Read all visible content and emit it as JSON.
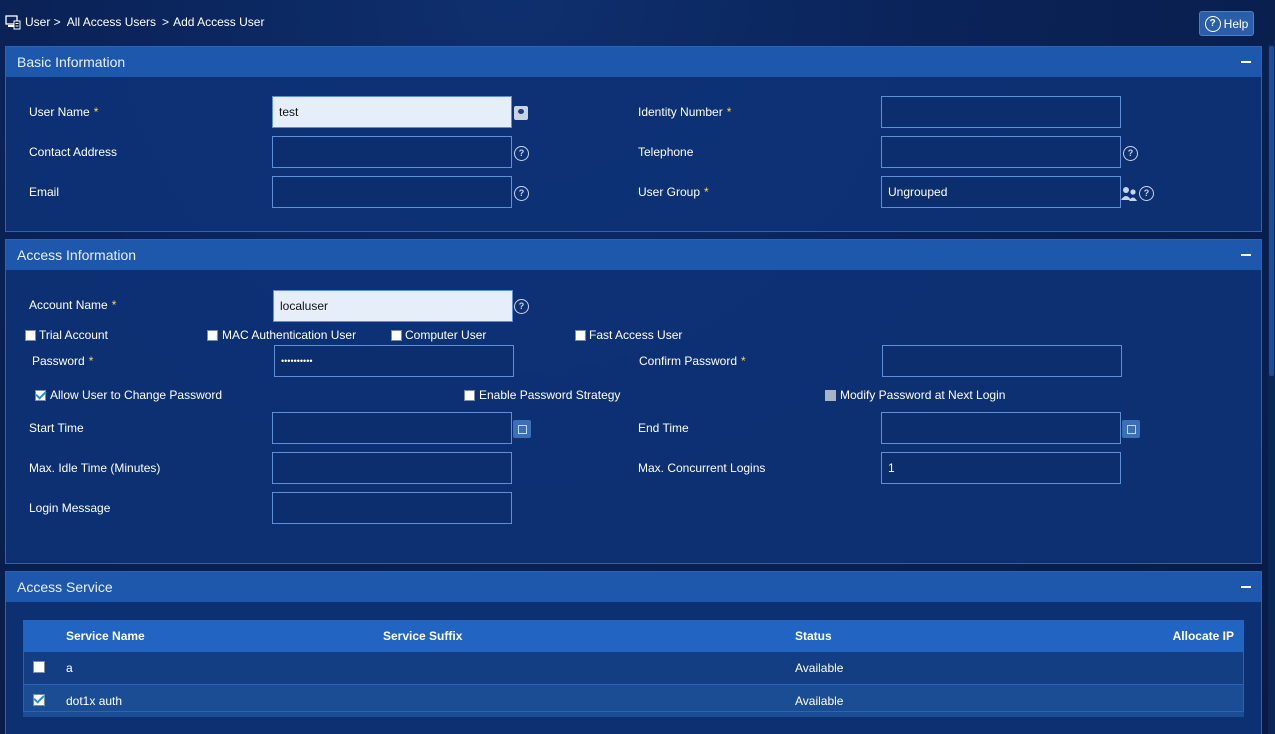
{
  "breadcrumb": {
    "item1": "User >",
    "item2": "All Access Users",
    "sep": ">",
    "item3": "Add Access User"
  },
  "help_label": "Help",
  "basic": {
    "title": "Basic Information",
    "user_name_label": "User Name",
    "user_name_value": "test",
    "identity_label": "Identity Number",
    "identity_value": "",
    "contact_label": "Contact Address",
    "contact_value": "",
    "telephone_label": "Telephone",
    "telephone_value": "",
    "email_label": "Email",
    "email_value": "",
    "group_label": "User Group",
    "group_value": "Ungrouped"
  },
  "access": {
    "title": "Access Information",
    "account_label": "Account Name",
    "account_value": "localuser",
    "trial_label": "Trial Account",
    "mac_label": "MAC Authentication User",
    "computer_label": "Computer User",
    "fast_label": "Fast Access User",
    "password_label": "Password",
    "password_value": "••••••••••",
    "confirm_label": "Confirm Password",
    "confirm_value": "",
    "allow_change_label": "Allow User to Change Password",
    "strategy_label": "Enable Password Strategy",
    "modify_next_label": "Modify Password at Next Login",
    "start_label": "Start Time",
    "start_value": "",
    "end_label": "End Time",
    "end_value": "",
    "idle_label": "Max. Idle Time (Minutes)",
    "idle_value": "",
    "concurrent_label": "Max. Concurrent Logins",
    "concurrent_value": "1",
    "login_msg_label": "Login Message",
    "login_msg_value": "",
    "required_mark": "*"
  },
  "service": {
    "title": "Access Service",
    "columns": [
      "Service Name",
      "Service Suffix",
      "Status",
      "Allocate IP"
    ],
    "rows": [
      {
        "name": "a",
        "suffix": "",
        "status": "Available",
        "checked": false
      },
      {
        "name": "dot1x auth",
        "suffix": "",
        "status": "Available",
        "checked": true
      }
    ]
  },
  "colors": {
    "panel_head": "#1d58ac",
    "accent": "#2164c2",
    "required": "#ffd94a"
  },
  "icons": [
    "home-icon",
    "help-icon",
    "user-card-icon",
    "question-icon",
    "group-icon",
    "calendar-icon",
    "collapse-icon",
    "checkbox-icon"
  ]
}
